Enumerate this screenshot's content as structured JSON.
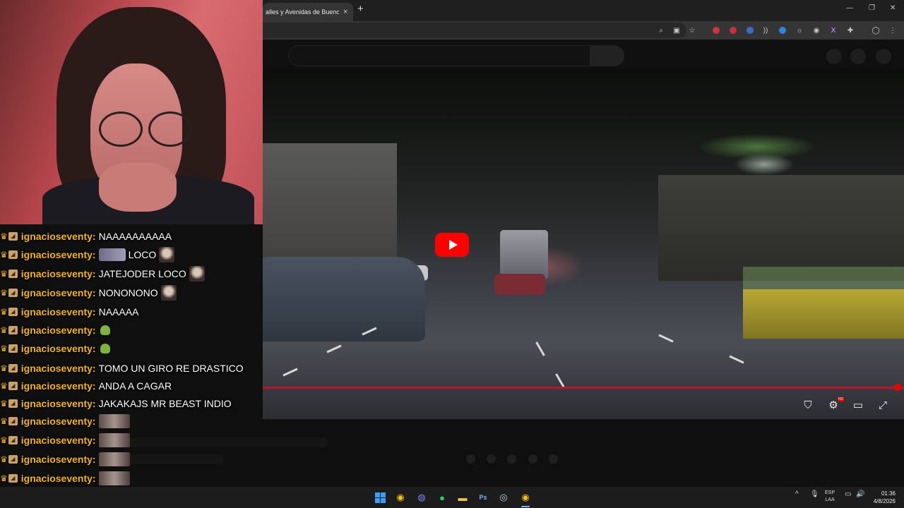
{
  "browser": {
    "tab_title": "alles y Avenidas de Buenos Ai",
    "tab_close": "×",
    "new_tab": "+",
    "window_controls": {
      "minimize": "—",
      "restore": "❐",
      "close": "✕"
    },
    "toolbar_icons": [
      "zoom-icon",
      "cast-icon",
      "bookmark-star-icon"
    ]
  },
  "video": {
    "play_button_color": "#ff0000",
    "progress_color": "#c4102a",
    "progress": 0.99,
    "controls": {
      "shield": "⛉",
      "settings": "⚙",
      "settings_badge": "HD",
      "theater": "▭",
      "fullscreen": "⤢"
    }
  },
  "chat": {
    "username_color": "#f5b51c",
    "messages": [
      {
        "user": "ignacioseventy",
        "text": "NAAAAAAAAAA"
      },
      {
        "user": "ignacioseventy",
        "text": "LOCO"
      },
      {
        "user": "ignacioseventy",
        "text": "JATEJODER LOCO"
      },
      {
        "user": "ignacioseventy",
        "text": "NONONONO"
      },
      {
        "user": "ignacioseventy",
        "text": "NAAAAA"
      },
      {
        "user": "ignacioseventy",
        "text": ""
      },
      {
        "user": "ignacioseventy",
        "text": ""
      },
      {
        "user": "ignacioseventy",
        "text": "TOMO UN GIRO RE DRASTICO"
      },
      {
        "user": "ignacioseventy",
        "text": "ANDA A CAGAR"
      },
      {
        "user": "ignacioseventy",
        "text": "JAKAKAJS MR BEAST INDIO"
      },
      {
        "user": "ignacioseventy",
        "text": ""
      },
      {
        "user": "ignacioseventy",
        "text": ""
      },
      {
        "user": "ignacioseventy",
        "text": ""
      },
      {
        "user": "ignacioseventy",
        "text": ""
      },
      {
        "user": "ignacioseventy",
        "text": ""
      }
    ],
    "colon": ":"
  },
  "taskbar": {
    "apps": [
      "windows-start-icon",
      "chrome-icon",
      "discord-icon",
      "spotify-icon",
      "file-explorer-icon",
      "photoshop-icon",
      "steam-icon",
      "chrome-active-icon"
    ],
    "tray_chevron": "^",
    "lang_line1": "ESP",
    "lang_line2": "LAA",
    "time": "01:36",
    "date": "4/8/2026"
  }
}
